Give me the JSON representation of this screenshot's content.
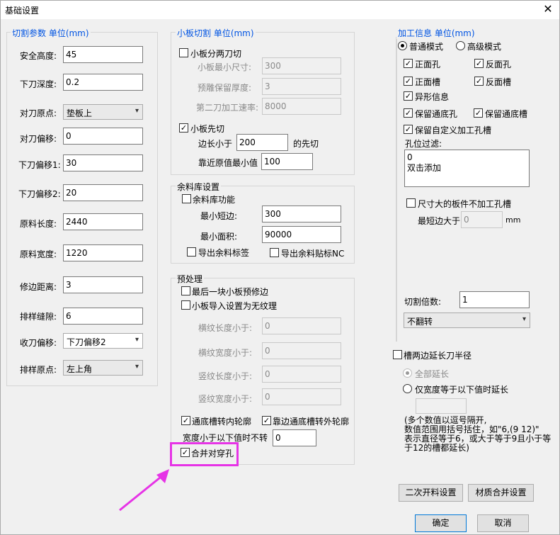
{
  "window": {
    "title": "基础设置",
    "close": "✕"
  },
  "cut": {
    "header": "切割参数 单位(mm)",
    "fields": [
      {
        "label": "安全高度:",
        "value": "45"
      },
      {
        "label": "下刀深度:",
        "value": "0.2"
      },
      {
        "label": "对刀原点:",
        "value": "垫板上"
      },
      {
        "label": "对刀偏移:",
        "value": "0"
      },
      {
        "label": "下刀偏移1:",
        "value": "30"
      },
      {
        "label": "下刀偏移2:",
        "value": "20"
      },
      {
        "label": "原料长度:",
        "value": "2440"
      },
      {
        "label": "原料宽度:",
        "value": "1220"
      },
      {
        "label": "修边距离:",
        "value": "3"
      },
      {
        "label": "排样缝隙:",
        "value": "6"
      },
      {
        "label": "收刀偏移:",
        "value": "下刀偏移2"
      },
      {
        "label": "排样原点:",
        "value": "左上角"
      }
    ]
  },
  "small": {
    "header": "小板切割 单位(mm)",
    "split_two": "小板分两刀切",
    "min_size_label": "小板最小尺寸:",
    "min_size": "300",
    "reserve_label": "预雕保留厚度:",
    "reserve": "3",
    "second_rate_label": "第二刀加工速率:",
    "second_rate": "8000",
    "first_cut": "小板先切",
    "edge_lt": "边长小于",
    "edge_val": "200",
    "first_suffix": "的先切",
    "near_label": "靠近原值最小值",
    "near_val": "100"
  },
  "remnant": {
    "header": "余料库设置",
    "enable": "余料库功能",
    "min_short_label": "最小短边:",
    "min_short": "300",
    "min_area_label": "最小面积:",
    "min_area": "90000",
    "export_label": "导出余料标签",
    "export_nc": "导出余料贴标NC"
  },
  "pre": {
    "header": "预处理",
    "last_trim": "最后一块小板预修边",
    "no_grain": "小板导入设置为无纹理",
    "h_len_label": "横纹长度小于:",
    "h_len": "0",
    "h_wid_label": "横纹宽度小于:",
    "h_wid": "0",
    "v_len_label": "竖纹长度小于:",
    "v_len": "0",
    "v_wid_label": "竖纹宽度小于:",
    "v_wid": "0",
    "slot_inner": "通底槽转内轮廓",
    "slot_outer": "靠边通底槽转外轮廓",
    "width_lt": "宽度小于以下值时不转",
    "width_val": "0",
    "merge_holes": "合并对穿孔"
  },
  "proc": {
    "header": "加工信息 单位(mm)",
    "mode_normal": "普通模式",
    "mode_adv": "高级模式",
    "front_hole": "正面孔",
    "back_hole": "反面孔",
    "front_slot": "正面槽",
    "back_slot": "反面槽",
    "shaped": "异形信息",
    "keep_thru_hole": "保留通底孔",
    "keep_thru_slot": "保留通底槽",
    "keep_custom": "保留自定义加工孔槽",
    "filter_label": "孔位过滤:",
    "filter_text": "0\n双击添加",
    "oversize": "尺寸大的板件不加工孔槽",
    "min_edge_label": "最短边大于",
    "min_edge": "0",
    "mm": "mm",
    "multiple_label": "切割倍数:",
    "multiple": "1",
    "flip": "不翻转"
  },
  "ext": {
    "slot_extend": "槽两边延长刀半径",
    "all_extend": "全部延长",
    "width_eq": "仅宽度等于以下值时延长",
    "note": "(多个数值以逗号隔开,\n数值范围用括号括住，如\"6,(9 12)\"\n表示直径等于6，或大于等于9且小于等\n于12的槽都延长)"
  },
  "buttons": {
    "secondary": "二次开料设置",
    "material": "材质合并设置",
    "ok": "确定",
    "cancel": "取消"
  }
}
